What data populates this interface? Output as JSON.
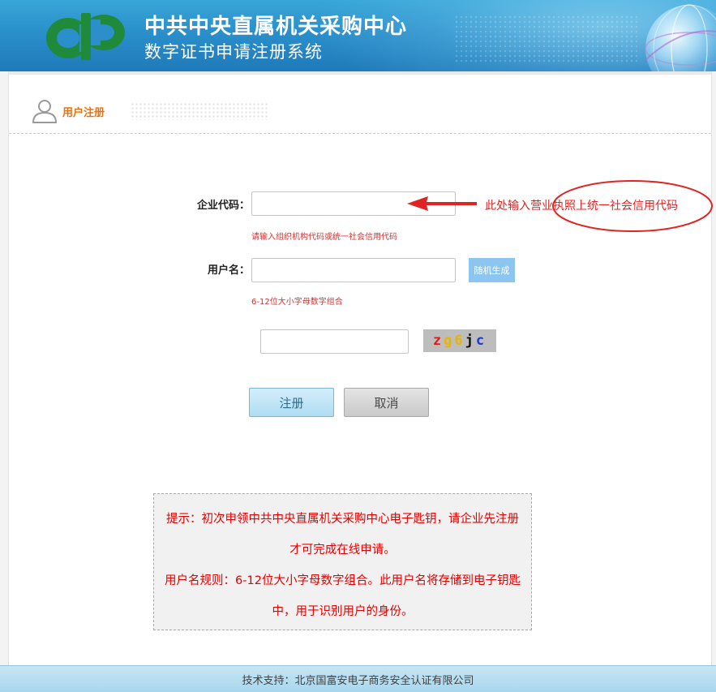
{
  "header": {
    "title": "中共中央直属机关采购中心",
    "subtitle": "数字证书申请注册系统"
  },
  "section": {
    "title": "用户注册",
    "icon": "user-icon"
  },
  "form": {
    "enterprise_code": {
      "label": "企业代码：",
      "value": "",
      "hint": "请输入组织机构代码或统一社会信用代码"
    },
    "username": {
      "label": "用户名：",
      "value": "",
      "hint": "6-12位大小字母数字组合",
      "random_button": "随机生成"
    },
    "captcha": {
      "value": "",
      "chars": [
        {
          "c": "z",
          "color": "#e01b1b"
        },
        {
          "c": "g",
          "color": "#e8b400"
        },
        {
          "c": "6",
          "color": "#e8b400"
        },
        {
          "c": "j",
          "color": "#111111"
        },
        {
          "c": "c",
          "color": "#1a3ad8"
        }
      ]
    },
    "submit_label": "注册",
    "cancel_label": "取消"
  },
  "annotation": {
    "text": "此处输入营业执照上统一社会信用代码",
    "color": "#e02424"
  },
  "notice": {
    "line1": "提示：初次申领中共中央直属机关采购中心电子匙钥，请企业先注册才可完成在线申请。",
    "line2": "用户名规则：6-12位大小字母数字组合。此用户名将存储到电子钥匙中，用于识别用户的身份。"
  },
  "footer": {
    "text": "技术支持：北京国富安电子商务安全认证有限公司"
  },
  "colors": {
    "banner": "#2a8fca",
    "accent_orange": "#e8730e",
    "hint_red": "#d43333",
    "notice_red": "#e60000",
    "random_button": "#8cc6f0"
  }
}
